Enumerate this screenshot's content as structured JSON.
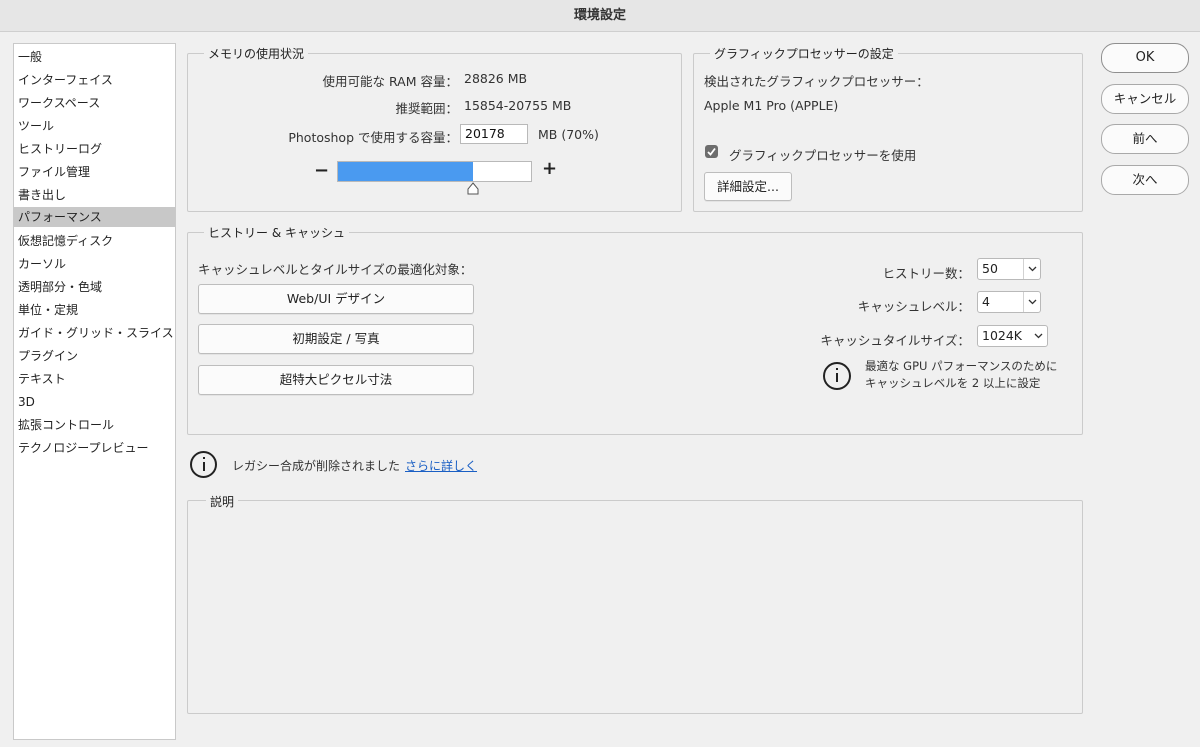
{
  "window": {
    "title": "環境設定"
  },
  "sidebar": {
    "items": [
      {
        "label": "一般"
      },
      {
        "label": "インターフェイス"
      },
      {
        "label": "ワークスペース"
      },
      {
        "label": "ツール"
      },
      {
        "label": "ヒストリーログ"
      },
      {
        "label": "ファイル管理"
      },
      {
        "label": "書き出し"
      },
      {
        "label": "パフォーマンス",
        "selected": true
      },
      {
        "label": "仮想記憶ディスク"
      },
      {
        "label": "カーソル"
      },
      {
        "label": "透明部分・色域"
      },
      {
        "label": "単位・定規"
      },
      {
        "label": "ガイド・グリッド・スライス"
      },
      {
        "label": "プラグイン"
      },
      {
        "label": "テキスト"
      },
      {
        "label": "3D"
      },
      {
        "label": "拡張コントロール"
      },
      {
        "label": "テクノロジープレビュー"
      }
    ]
  },
  "memory": {
    "title": "メモリの使用状況",
    "available_label": "使用可能な RAM 容量：",
    "available_value": "28826 MB",
    "range_label": "推奨範囲：",
    "range_value": "15854-20755 MB",
    "usage_label": "Photoshop で使用する容量：",
    "usage_value": "20178",
    "usage_unit": "MB (70%)",
    "usage_fraction": 0.7,
    "minus": "−",
    "plus": "+"
  },
  "gpu": {
    "title": "グラフィックプロセッサーの設定",
    "detected_label": "検出されたグラフィックプロセッサー：",
    "detected_value": "Apple M1 Pro (APPLE)",
    "use_gpu_label": "グラフィックプロセッサーを使用",
    "use_gpu_checked": true,
    "advanced_button": "詳細設定..."
  },
  "history_cache": {
    "title": "ヒストリー & キャッシュ",
    "optimize_label": "キャッシュレベルとタイルサイズの最適化対象：",
    "preset_buttons": [
      "Web/UI デザイン",
      "初期設定 / 写真",
      "超特大ピクセル寸法"
    ],
    "history_label": "ヒストリー数：",
    "history_value": "50",
    "cache_level_label": "キャッシュレベル：",
    "cache_level_value": "4",
    "tile_size_label": "キャッシュタイルサイズ：",
    "tile_size_value": "1024K",
    "gpu_note_line1": "最適な GPU パフォーマンスのために",
    "gpu_note_line2": "キャッシュレベルを 2 以上に設定"
  },
  "legacy": {
    "message": "レガシー合成が削除されました",
    "link": "さらに詳しく"
  },
  "description": {
    "title": "説明"
  },
  "buttons": {
    "ok": "OK",
    "cancel": "キャンセル",
    "prev": "前へ",
    "next": "次へ"
  },
  "colors": {
    "slider_fill": "#4a9af0",
    "link": "#1a5fc4",
    "selected_row": "#c8c8c8"
  }
}
